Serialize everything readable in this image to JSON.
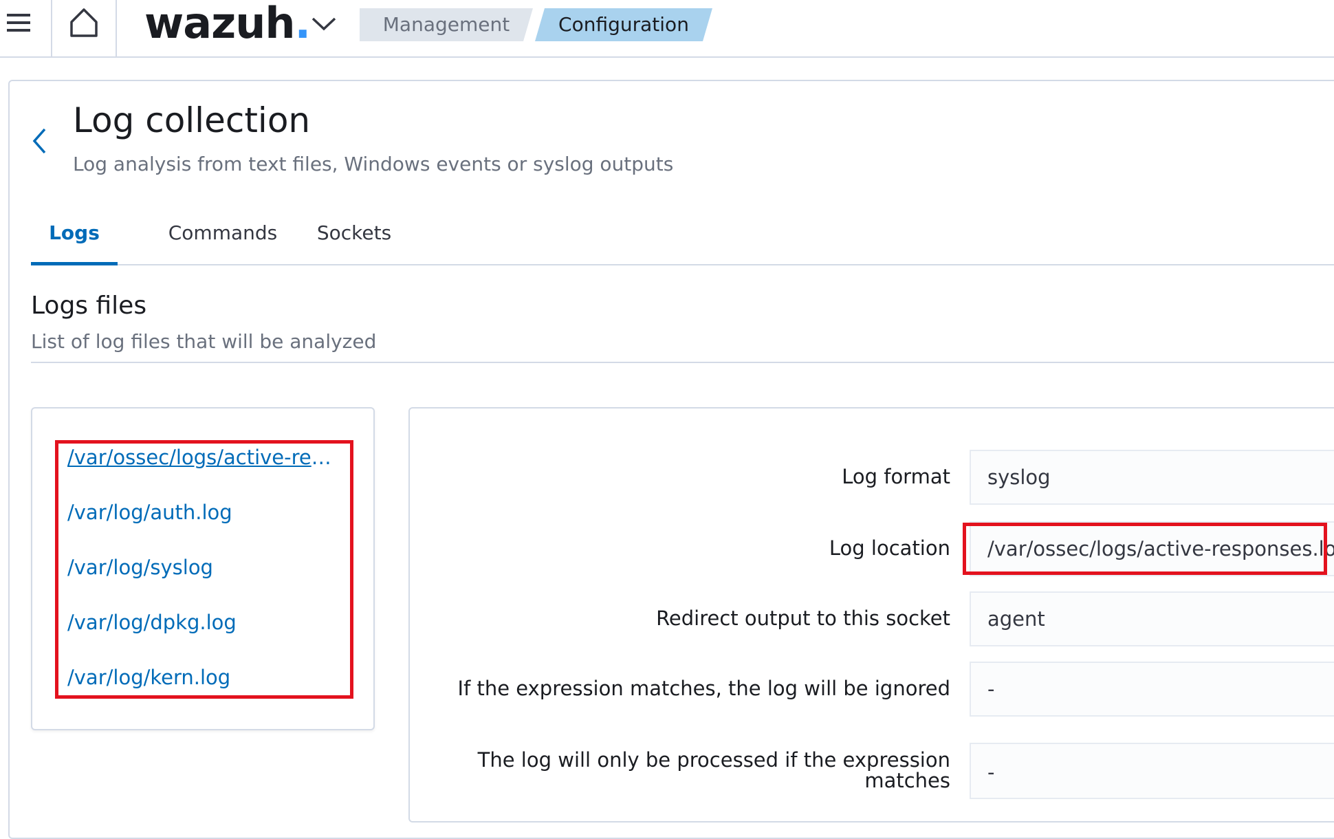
{
  "topbar": {
    "logo_text": "wazuh",
    "logo_dot": ".",
    "breadcrumbs": [
      "Management",
      "Configuration"
    ]
  },
  "page": {
    "title": "Log collection",
    "subtitle": "Log analysis from text files, Windows events or syslog outputs"
  },
  "tabs": [
    {
      "label": "Logs",
      "active": true
    },
    {
      "label": "Commands",
      "active": false
    },
    {
      "label": "Sockets",
      "active": false
    }
  ],
  "section": {
    "title": "Logs files",
    "subtitle": "List of log files that will be analyzed"
  },
  "files": [
    "/var/ossec/logs/active-responses.log",
    "/var/log/auth.log",
    "/var/log/syslog",
    "/var/log/dpkg.log",
    "/var/log/kern.log"
  ],
  "details": [
    {
      "label": "Log format",
      "value": "syslog"
    },
    {
      "label": "Log location",
      "value": "/var/ossec/logs/active-responses.log"
    },
    {
      "label": "Redirect output to this socket",
      "value": "agent"
    },
    {
      "label": "If the expression matches, the log will be ignored",
      "value": "-"
    },
    {
      "label": "The log will only be processed if the expression matches",
      "value": "-"
    }
  ],
  "colors": {
    "accent": "#006bb8",
    "highlight": "#e3121e",
    "logo_dot": "#3595f9"
  }
}
